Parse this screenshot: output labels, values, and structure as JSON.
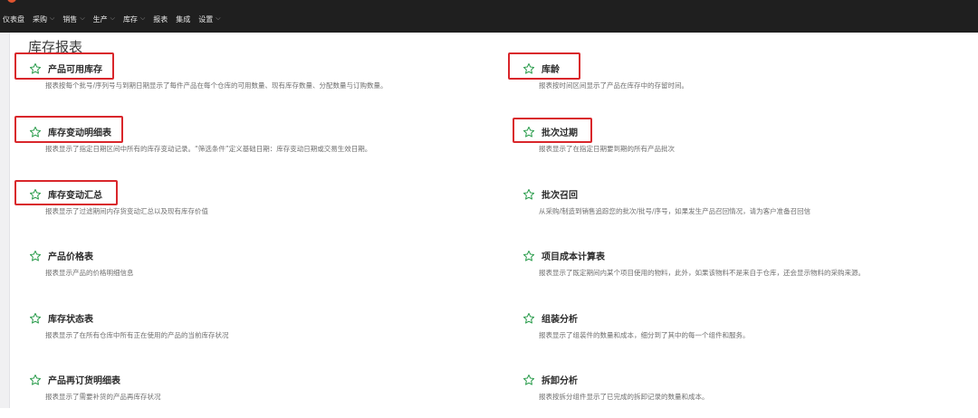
{
  "nav": {
    "items": [
      {
        "label": "仪表盘",
        "has_menu": false
      },
      {
        "label": "采购",
        "has_menu": true
      },
      {
        "label": "销售",
        "has_menu": true
      },
      {
        "label": "生产",
        "has_menu": true
      },
      {
        "label": "库存",
        "has_menu": true
      },
      {
        "label": "报表",
        "has_menu": false
      },
      {
        "label": "集成",
        "has_menu": false
      },
      {
        "label": "设置",
        "has_menu": true
      }
    ]
  },
  "page": {
    "title": "库存报表"
  },
  "reports": [
    {
      "title": "产品可用库存",
      "desc": "报表按每个批号/序列号与到期日期显示了每件产品在每个仓库的可用数量、现有库存数量、分配数量与订购数量。",
      "highlighted": true
    },
    {
      "title": "库龄",
      "desc": "报表按时间区间显示了产品在库存中的存留时间。",
      "highlighted": true
    },
    {
      "title": "库存变动明细表",
      "desc": "报表显示了指定日期区间中所有的库存变动记录。“筛选条件”定义基础日期：库存变动日期或交易生效日期。",
      "highlighted": true
    },
    {
      "title": "批次过期",
      "desc": "报表显示了在指定日期要到期的所有产品批次",
      "highlighted": true
    },
    {
      "title": "库存变动汇总",
      "desc": "报表显示了过滤期间内存货变动汇总以及现有库存价值",
      "highlighted": true
    },
    {
      "title": "批次召回",
      "desc": "从采购/制造到销售追踪您的批次/批号/序号，如果发生产品召回情况，请为客户准备召回信",
      "highlighted": false
    },
    {
      "title": "产品价格表",
      "desc": "报表显示产品的价格明细信息",
      "highlighted": false
    },
    {
      "title": "项目成本计算表",
      "desc": "报表显示了既定期间内某个项目使用的物料，此外，如果该物料不是来自于仓库，还会显示物料的采购来源。",
      "highlighted": false
    },
    {
      "title": "库存状态表",
      "desc": "报表显示了在所有仓库中所有正在使用的产品的当前库存状况",
      "highlighted": false
    },
    {
      "title": "组装分析",
      "desc": "报表显示了组装件的数量和成本，细分到了其中的每一个组件和服务。",
      "highlighted": false
    },
    {
      "title": "产品再订货明细表",
      "desc": "报表显示了需要补货的产品再库存状况",
      "highlighted": false
    },
    {
      "title": "拆卸分析",
      "desc": "报表按拆分组件显示了已完成的拆卸记录的数量和成本。",
      "highlighted": false
    }
  ],
  "colors": {
    "topbar": "#1f1f1f",
    "star": "#2e9e4f",
    "highlight": "#d9262b"
  }
}
